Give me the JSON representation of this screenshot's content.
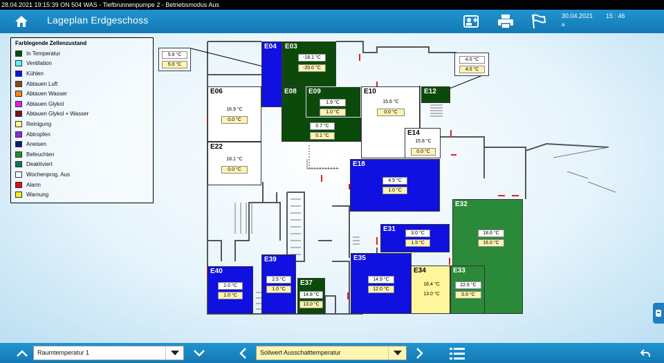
{
  "status_line": "28.04.2021 19:15:39   ON   504 WAS - Tiefbrunnenpumpe 2 - Betriebsmodus Aus",
  "header": {
    "title": "Lageplan Erdgeschoss",
    "date": "30.04.2021",
    "date_sub": "a",
    "time": "15 : 46",
    "icons": [
      "home-icon",
      "user-transfer-icon",
      "printer-icon",
      "flag-icon"
    ]
  },
  "legend": {
    "title": "Farblegende Zellenzustand",
    "items": [
      {
        "label": "In Temperatur",
        "color": "#0b4a0b"
      },
      {
        "label": "Ventilation",
        "color": "#5ff0f0"
      },
      {
        "label": "Kühlen",
        "color": "#1010e0"
      },
      {
        "label": "Abtauen Luft",
        "color": "#8a4a14"
      },
      {
        "label": "Abtauen Wasser",
        "color": "#f08a1a"
      },
      {
        "label": "Abtauen Glykol",
        "color": "#e020e0"
      },
      {
        "label": "Abtauen Glykol + Wasser",
        "color": "#7a1020"
      },
      {
        "label": "Reinigung",
        "color": "#ffff80"
      },
      {
        "label": "Abtropfen",
        "color": "#8a2be2"
      },
      {
        "label": "Aneisen",
        "color": "#0c1a7a"
      },
      {
        "label": "Befeuchten",
        "color": "#2a8a2a"
      },
      {
        "label": "Deaktiviert",
        "color": "#0a7a55"
      },
      {
        "label": "Wochenprog. Aus",
        "color": "#ffffff"
      },
      {
        "label": "Alarm",
        "color": "#e01010"
      },
      {
        "label": "Warnung",
        "color": "#f5f01a"
      }
    ]
  },
  "rooms": {
    "E03": {
      "label": "E03",
      "cur": "-18.1 °C",
      "set": "-20.0 °C",
      "color": "#0b4a0b"
    },
    "E04": {
      "label": "E04",
      "cur": "5.6 °C",
      "set": "5.0 °C",
      "color": "#1010e0"
    },
    "E06": {
      "label": "E06",
      "cur": "16.9 °C",
      "set": "0.0 °C",
      "color": "#ffffff"
    },
    "E08": {
      "label": "E08",
      "cur": "0.7 °C",
      "set": "0.1 °C",
      "color": "#0b4a0b"
    },
    "E09": {
      "label": "E09",
      "cur": "1.9 °C",
      "set": "1.0 °C",
      "color": "#0b4a0b"
    },
    "E10": {
      "label": "E10",
      "cur": "15.6 °C",
      "set": "0.0 °C",
      "color": "#ffffff"
    },
    "E12": {
      "label": "E12",
      "cur": "4.0 °C",
      "set": "4.0 °C",
      "color": "#0b4a0b"
    },
    "E14": {
      "label": "E14",
      "cur": "15.8 °C",
      "set": "0.0 °C",
      "color": "#ffffff"
    },
    "E18": {
      "label": "E18",
      "cur": "4.5 °C",
      "set": "1.0 °C",
      "color": "#1010e0"
    },
    "E22": {
      "label": "E22",
      "cur": "18.1 °C",
      "set": "0.0 °C",
      "color": "#ffffff"
    },
    "E31": {
      "label": "E31",
      "cur": "3.0 °C",
      "set": "1.5 °C",
      "color": "#1010e0"
    },
    "E32": {
      "label": "E32",
      "cur": "18.6 °C",
      "set": "16.0 °C",
      "color": "#2a8a3a"
    },
    "E33": {
      "label": "E33",
      "cur": "22.6 °C",
      "set": "0.0 °C",
      "color": "#2a8a3a"
    },
    "E34": {
      "label": "E34",
      "cur": "16.4 °C",
      "set": "13.0 °C",
      "color": "#fff59a"
    },
    "E35": {
      "label": "E35",
      "cur": "14.9 °C",
      "set": "12.0 °C",
      "color": "#1010e0"
    },
    "E37": {
      "label": "E37",
      "cur": "14.8 °C",
      "set": "13.0 °C",
      "color": "#0b4a0b"
    },
    "E39": {
      "label": "E39",
      "cur": "2.5 °C",
      "set": "1.0 °C",
      "color": "#1010e0"
    },
    "E40": {
      "label": "E40",
      "cur": "2.0 °C",
      "set": "1.0 °C",
      "color": "#1010e0"
    }
  },
  "bottom": {
    "select1": "Raumtemperatur 1",
    "select2": "Sollwert Ausschalttemperatur"
  }
}
